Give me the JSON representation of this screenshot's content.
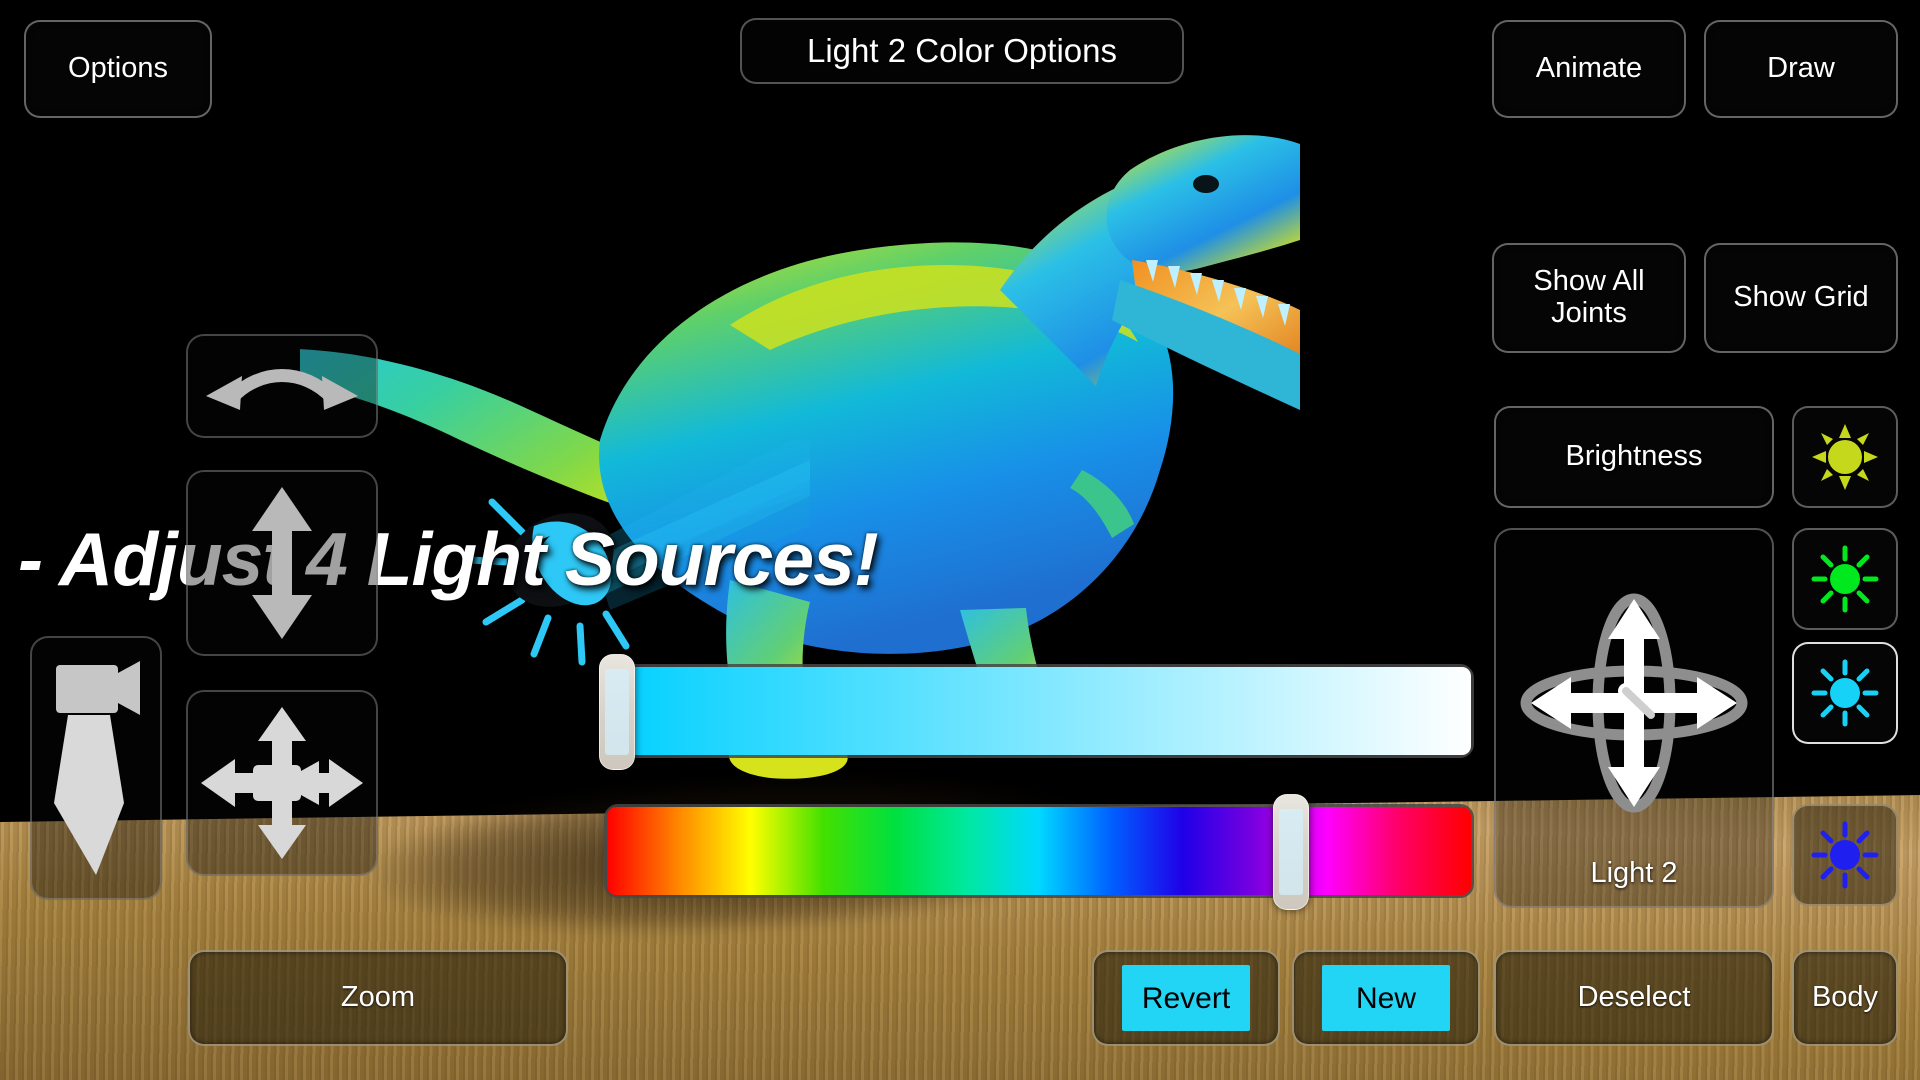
{
  "app": {
    "title": "Light 2 Color Options",
    "promo_text": "- Adjust 4 Light Sources!"
  },
  "top_bar": {
    "options_label": "Options",
    "animate_label": "Animate",
    "draw_label": "Draw"
  },
  "right_panel": {
    "show_all_joints_label": "Show All Joints",
    "show_grid_label": "Show Grid",
    "brightness_label": "Brightness",
    "gizmo_label": "Light 2",
    "deselect_label": "Deselect",
    "body_label": "Body",
    "lights": [
      {
        "name": "light-1",
        "color": "#c6d81c",
        "selected": false,
        "on_floor": false
      },
      {
        "name": "light-2",
        "color": "#00e81e",
        "selected": false,
        "on_floor": false
      },
      {
        "name": "light-3",
        "color": "#16d2f7",
        "selected": true,
        "on_floor": false
      },
      {
        "name": "light-4",
        "color": "#1f1ff0",
        "selected": false,
        "on_floor": true
      }
    ]
  },
  "left_controls": {
    "rotate_label": "rotate-arc-icon",
    "vertical_label": "vertical-arrows-icon",
    "camera_height_label": "camera-down-arrow-icon",
    "camera_pan_label": "camera-pan-arrows-icon",
    "zoom_label": "Zoom"
  },
  "sliders": {
    "brightness": {
      "name": "brightness-slider",
      "from_color": "#00d0ff",
      "to_color": "#ffffff",
      "value_percent": 1
    },
    "hue": {
      "name": "hue-slider",
      "value_percent": 79,
      "stops": [
        "#ff0000",
        "#ff8800",
        "#ffff00",
        "#44e000",
        "#00e040",
        "#00e8a0",
        "#00d8ff",
        "#0060ff",
        "#2000e8",
        "#7a00e0",
        "#ff00ff",
        "#ff0066",
        "#ff0000"
      ]
    }
  },
  "color_actions": {
    "revert_label": "Revert",
    "revert_swatch": "#22d5f5",
    "new_label": "New",
    "new_swatch": "#22d5f5"
  },
  "scene": {
    "light_gizmo_color": "#28c8f5"
  }
}
